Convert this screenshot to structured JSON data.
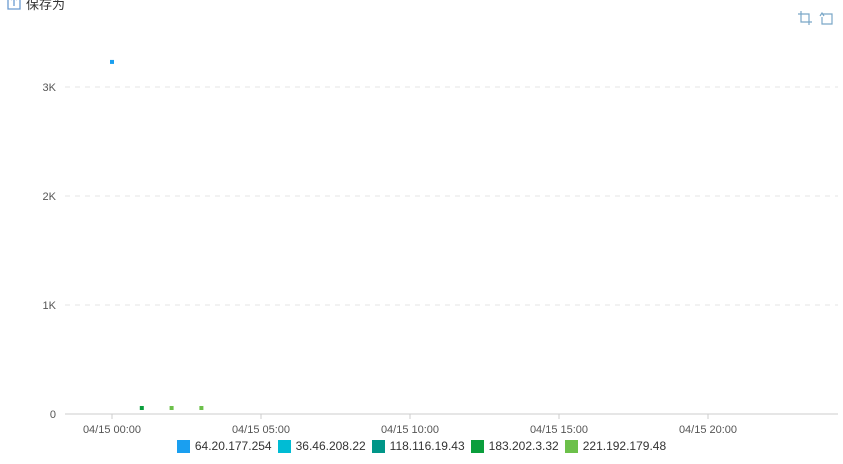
{
  "save_label": "保存为",
  "colors": {
    "axis": "#cccccc",
    "grid": "#e6e6e6",
    "text": "#555555"
  },
  "chart_data": {
    "type": "scatter",
    "xlim": [
      "04/15 00:00",
      "04/16 00:00"
    ],
    "ylim": [
      0,
      3300
    ],
    "x_ticks": [
      "04/15 00:00",
      "04/15 05:00",
      "04/15 10:00",
      "04/15 15:00",
      "04/15 20:00"
    ],
    "y_ticks": [
      {
        "value": 0,
        "label": "0"
      },
      {
        "value": 1000,
        "label": "1K"
      },
      {
        "value": 2000,
        "label": "2K"
      },
      {
        "value": 3000,
        "label": "3K"
      }
    ],
    "grid": true,
    "legend_position": "bottom",
    "series": [
      {
        "name": "64.20.177.254",
        "color": "#1a9ff0",
        "points": [
          {
            "x": "04/15 00:00",
            "y": 3230
          }
        ]
      },
      {
        "name": "36.46.208.22",
        "color": "#00bcd4",
        "points": []
      },
      {
        "name": "118.116.19.43",
        "color": "#009688",
        "points": []
      },
      {
        "name": "183.202.3.32",
        "color": "#0a9e3c",
        "points": [
          {
            "x": "04/15 01:00",
            "y": 55
          }
        ]
      },
      {
        "name": "221.192.179.48",
        "color": "#6cc04a",
        "points": [
          {
            "x": "04/15 02:00",
            "y": 55
          },
          {
            "x": "04/15 03:00",
            "y": 55
          }
        ]
      }
    ]
  }
}
